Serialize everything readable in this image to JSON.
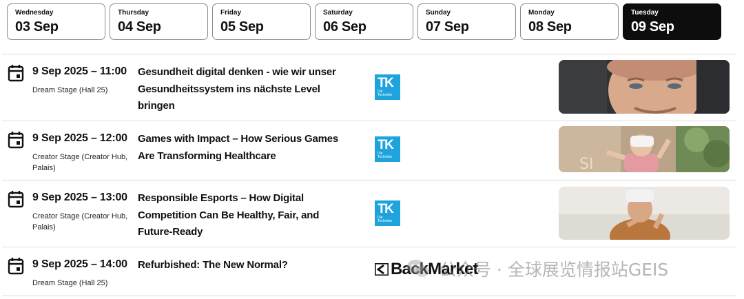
{
  "days": [
    {
      "weekday": "Wednesday",
      "date": "03 Sep"
    },
    {
      "weekday": "Thursday",
      "date": "04 Sep"
    },
    {
      "weekday": "Friday",
      "date": "05 Sep"
    },
    {
      "weekday": "Saturday",
      "date": "06 Sep"
    },
    {
      "weekday": "Sunday",
      "date": "07 Sep"
    },
    {
      "weekday": "Monday",
      "date": "08 Sep"
    },
    {
      "weekday": "Tuesday",
      "date": "09 Sep",
      "active": true
    }
  ],
  "sessions": [
    {
      "datetime": "9 Sep 2025 – 11:00",
      "venue": "Dream Stage (Hall 25)",
      "title": "Gesundheit digital denken - wie wir unser Gesundheitssystem ins nächste Level bringen",
      "sponsor": {
        "mark": "TK",
        "sub": "Die Techniker"
      }
    },
    {
      "datetime": "9 Sep 2025 – 12:00",
      "venue": "Creator Stage (Creator Hub, Palais)",
      "title": "Games with Impact – How Serious Games Are Transforming Healthcare",
      "sponsor": {
        "mark": "TK",
        "sub": "Die Techniker"
      }
    },
    {
      "datetime": "9 Sep 2025 – 13:00",
      "venue": "Creator Stage (Creator Hub, Palais)",
      "title": "Responsible Esports – How Digital Competition Can Be Healthy, Fair, and Future-Ready",
      "sponsor": {
        "mark": "TK",
        "sub": "Die Techniker"
      }
    },
    {
      "datetime": "9 Sep 2025 – 14:00",
      "venue": "Dream Stage (Hall 25)",
      "title": "Refurbished: The New Normal?",
      "sponsor": {
        "name": "BackMarket"
      }
    }
  ],
  "watermark": {
    "text": "公众号 · 全球展览情报站GEIS"
  },
  "colors": {
    "active_tab": "#0d0d0d",
    "tk_blue": "#1ea3dc",
    "divider": "#dcdcdc"
  }
}
